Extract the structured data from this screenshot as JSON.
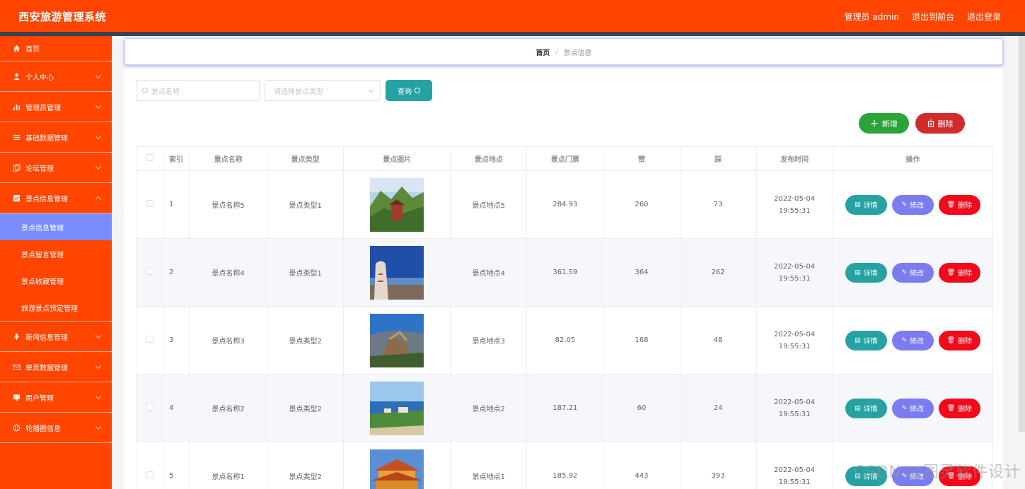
{
  "header": {
    "title": "西安旅游管理系统",
    "user": "管理员 admin",
    "back_front": "退出到前台",
    "logout": "退出登录"
  },
  "sidebar": {
    "items": [
      {
        "label": "首页",
        "icon": "home-icon"
      },
      {
        "label": "个人中心",
        "icon": "user-icon"
      },
      {
        "label": "管理员管理",
        "icon": "chart-icon"
      },
      {
        "label": "基础数据管理",
        "icon": "sliders-icon"
      },
      {
        "label": "论坛管理",
        "icon": "copy-icon"
      },
      {
        "label": "景点信息管理",
        "icon": "checkbox-icon"
      },
      {
        "label": "新闻信息管理",
        "icon": "microphone-icon"
      },
      {
        "label": "单页数据管理",
        "icon": "mail-icon"
      },
      {
        "label": "用户管理",
        "icon": "monitor-icon"
      },
      {
        "label": "轮播图信息",
        "icon": "globe-icon"
      }
    ],
    "sub_items": [
      "景点信息管理",
      "景点留言管理",
      "景点收藏管理",
      "旅游景点预定管理"
    ]
  },
  "breadcrumb": {
    "home": "首页",
    "sep": "/",
    "current": "景点信息"
  },
  "search": {
    "name_placeholder": "景点名称",
    "type_placeholder": "请选择景点类型",
    "query_label": "查询"
  },
  "actions": {
    "add_label": "新增",
    "delete_label": "删除"
  },
  "table": {
    "columns": [
      "索引",
      "景点名称",
      "景点类型",
      "景点图片",
      "景点地点",
      "景点门票",
      "赞",
      "踩",
      "发布时间",
      "操作"
    ],
    "rows": [
      {
        "index": "1",
        "name": "景点名称5",
        "type": "景点类型1",
        "place": "景点地点5",
        "ticket": "284.93",
        "likes": "260",
        "dislikes": "73",
        "time": "2022-05-04 19:55:31"
      },
      {
        "index": "2",
        "name": "景点名称4",
        "type": "景点类型1",
        "place": "景点地点4",
        "ticket": "361.59",
        "likes": "364",
        "dislikes": "262",
        "time": "2022-05-04 19:55:31"
      },
      {
        "index": "3",
        "name": "景点名称3",
        "type": "景点类型2",
        "place": "景点地点3",
        "ticket": "82.05",
        "likes": "168",
        "dislikes": "48",
        "time": "2022-05-04 19:55:31"
      },
      {
        "index": "4",
        "name": "景点名称2",
        "type": "景点类型2",
        "place": "景点地点2",
        "ticket": "187.21",
        "likes": "60",
        "dislikes": "24",
        "time": "2022-05-04 19:55:31"
      },
      {
        "index": "5",
        "name": "景点名称1",
        "type": "景点类型2",
        "place": "景点地点1",
        "ticket": "185.92",
        "likes": "443",
        "dislikes": "393",
        "time": "2022-05-04 19:55:31"
      }
    ],
    "row_actions": {
      "detail": "详情",
      "edit": "修改",
      "delete": "删除"
    }
  },
  "watermark": "CSDN @图灵软件设计",
  "colors": {
    "header": "#ff4500",
    "sidebar": "#ff4500",
    "active_sub": "#7b8cff",
    "query": "#26a2a2",
    "add": "#2aa33b",
    "delete": "#d12b2b",
    "edit": "#7b7cf0",
    "remove": "#f10a1a"
  }
}
